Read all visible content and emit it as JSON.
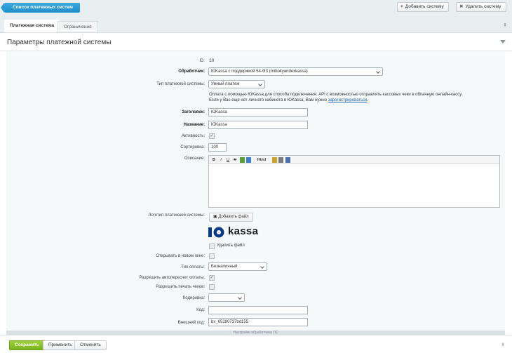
{
  "header": {
    "back_label": "Список платежных систем",
    "add_label": "Добавить систему",
    "delete_label": "Удалить систему"
  },
  "tabs": [
    {
      "label": "Платежная система",
      "active": true
    },
    {
      "label": "Ограничения",
      "active": false
    }
  ],
  "panel": {
    "title": "Параметры платежной системы"
  },
  "form": {
    "id_label": "ID:",
    "id_value": "10",
    "handler_label": "Обработчик:",
    "handler_value": "ЮKassa с поддержкой 54-ФЗ (mibokyandexkassa)",
    "type_label": "Тип платежной системы:",
    "type_value": "Умный платеж",
    "note_line1": "Оплата с помощью ЮKassa для способа подключения. API с возможностью отправлять кассовых чеки в облачную онлайн-кассу",
    "note_line2_prefix": "Если у Вас еще нет личного кабинета в ЮKassa, Вам нужно",
    "note_line2_link": "зарегистрироваться",
    "note_line2_suffix": ".",
    "title_label": "Заголовок:",
    "title_value": "ЮKassa",
    "name_label": "Название:",
    "name_value": "ЮKassa",
    "active_label": "Активность:",
    "sort_label": "Сортировка:",
    "sort_value": "100",
    "description_label": "Описание:",
    "logo_label": "Логотип платежной системы:",
    "upload_label": "Добавить файл",
    "logo_text": "kassa",
    "delete_file_label": "Удалить файл",
    "new_window_label": "Открывать в новом окне:",
    "pay_type_label": "Тип оплаты:",
    "pay_type_value": "Безналичный",
    "auto_recalc_label": "Разрешить автопересчет оплаты:",
    "allow_print_label": "Разрешить печать чеков:",
    "encoding_label": "Кодировка:",
    "encoding_value": "",
    "code_label": "Код:",
    "code_value": "",
    "external_code_label": "Внешний код:",
    "external_code_value": "bx_65280737bd155"
  },
  "editor_toolbar": [
    "B",
    "I",
    "U",
    "S",
    "Html"
  ],
  "bottom_strip": "Настройки обработчика ПС",
  "footer": {
    "save_label": "Сохранить",
    "apply_label": "Применить",
    "cancel_label": "Отменить"
  },
  "colors": {
    "accent_blue": "#1f8fcb",
    "save_green": "#79b41c",
    "link": "#2067b0"
  }
}
